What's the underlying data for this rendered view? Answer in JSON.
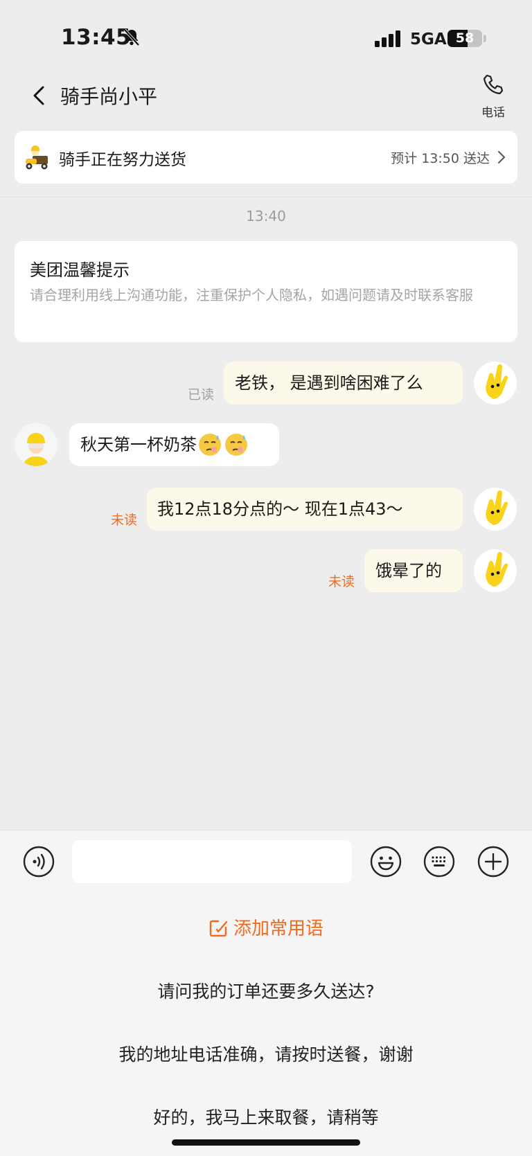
{
  "status_bar": {
    "time": "13:45",
    "network": "5GA",
    "battery": "58",
    "battery_level": 0.58
  },
  "nav": {
    "title": "骑手尚小平",
    "call_label": "电话"
  },
  "delivery": {
    "status": "骑手正在努力送货",
    "eta": "预计 13:50 送达"
  },
  "chat": {
    "timestamp": "13:40",
    "notice": {
      "title": "美团温馨提示",
      "body": "请合理利用线上沟通功能，注重保护个人隐私，如遇问题请及时联系客服"
    },
    "messages": [
      {
        "sender": "me",
        "text": "老铁， 是遇到啥困难了么",
        "status": "已读"
      },
      {
        "sender": "rider",
        "text": "秋天第一杯奶茶",
        "emoji": [
          "sweating-face",
          "sweating-face"
        ]
      },
      {
        "sender": "me",
        "text": "我12点18分点的～ 现在1点43～",
        "status": "未读"
      },
      {
        "sender": "me",
        "text": "饿晕了的",
        "status": "未读"
      }
    ]
  },
  "input": {
    "placeholder": ""
  },
  "quick_phrases": {
    "add_label": "添加常用语",
    "items": [
      "请问我的订单还要多久送达?",
      "我的地址电话准确，请按时送餐，谢谢",
      "好的，我马上来取餐，请稍等"
    ]
  },
  "colors": {
    "accent": "#f36a1c",
    "my_bubble": "#fdf9ea",
    "background": "#ededed"
  }
}
